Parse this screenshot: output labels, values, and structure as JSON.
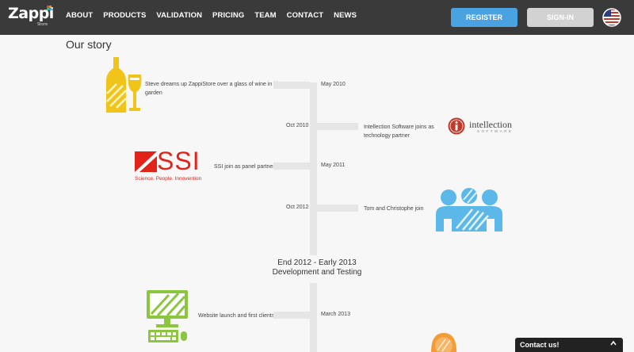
{
  "brand": {
    "name": "Zappi",
    "sub": "Store"
  },
  "nav": {
    "items": [
      "ABOUT",
      "PRODUCTS",
      "VALIDATION",
      "PRICING",
      "TEAM",
      "CONTACT",
      "NEWS"
    ]
  },
  "header_buttons": {
    "register": "REGISTER",
    "signin": "SIGN-IN"
  },
  "page": {
    "title": "Our story"
  },
  "timeline": {
    "e1": {
      "text_l1": "Steve dreams up ZappiStore over a glass of wine in his",
      "text_l2": "garden",
      "date": "May 2010"
    },
    "e2": {
      "date": "Oct 2010",
      "text_l1": "Intellection Software joins as",
      "text_l2": "technology partner"
    },
    "e3": {
      "text": "SSI join as panel partner",
      "date": "May 2011"
    },
    "e4": {
      "date": "Oct 2012",
      "text": "Tom and Christophe join"
    },
    "phase": {
      "l1": "End 2012 - Early 2013",
      "l2": "Development and Testing"
    },
    "e5": {
      "text": "Website launch and first clients",
      "date": "March 2013"
    }
  },
  "logos": {
    "ssi": {
      "name": "SSI",
      "tagline": "Science. People. Innovention",
      "color": "#e2231a"
    },
    "intellection": {
      "name": "intellection",
      "sub": "SOFTWARE",
      "color": "#c0392b"
    }
  },
  "colors": {
    "header_bg": "#3a3a3a",
    "register": "#4aa3e0",
    "wine": "#f0c419",
    "people": "#5bb8e8",
    "computer": "#8cc63f",
    "badge": "#f39c35"
  },
  "contact": {
    "label": "Contact us!"
  }
}
